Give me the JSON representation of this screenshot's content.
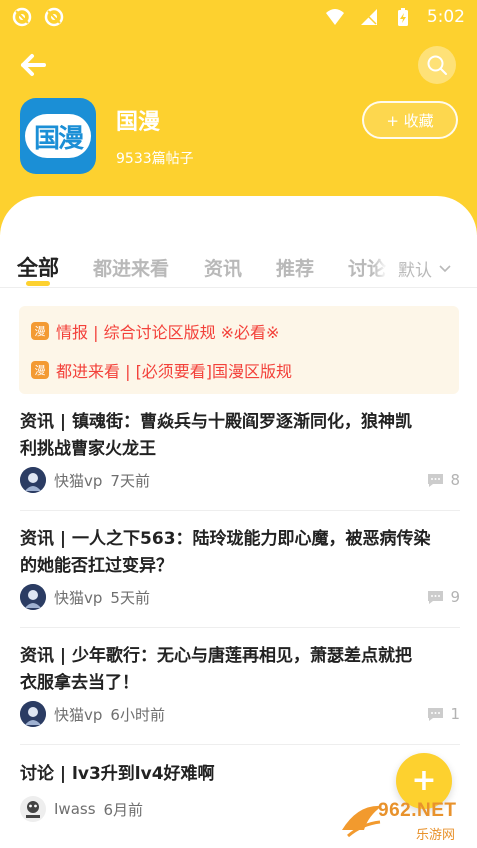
{
  "status_bar": {
    "time": "5:02"
  },
  "forum": {
    "logo_text": "国漫",
    "name": "国漫",
    "post_count": "9533篇帖子",
    "favorite_label": "+ 收藏"
  },
  "tabs": [
    {
      "label": "全部",
      "active": true
    },
    {
      "label": "都进来看",
      "active": false
    },
    {
      "label": "资讯",
      "active": false
    },
    {
      "label": "推荐",
      "active": false
    },
    {
      "label": "讨论",
      "active": false
    }
  ],
  "sort": {
    "selected": "默认"
  },
  "notices": [
    {
      "badge": "漫",
      "text": "情报 | 综合讨论区版规 ※必看※"
    },
    {
      "badge": "漫",
      "text": "都进来看 | [必须要看]国漫区版规"
    }
  ],
  "posts": [
    {
      "title_line1": "资讯 | 镇魂街：曹焱兵与十殿阎罗逐渐同化，狼神凯",
      "title_line2": "利挑战曹家火龙王",
      "author": "快猫vp",
      "time": "7天前",
      "comments": "8"
    },
    {
      "title_line1": "资讯 | 一人之下563：陆玲珑能力即心魔，被恶病传染",
      "title_line2": "的她能否扛过变异？",
      "author": "快猫vp",
      "time": "5天前",
      "comments": "9"
    },
    {
      "title_line1": "资讯 | 少年歌行：无心与唐莲再相见，萧瑟差点就把",
      "title_line2": "衣服拿去当了！",
      "author": "快猫vp",
      "time": "6小时前",
      "comments": "1"
    },
    {
      "title_line1": "讨论 | lv3升到lv4好难啊",
      "title_line2": "",
      "author": "Iwass",
      "time": "6月前",
      "comments": ""
    }
  ],
  "fab": {
    "label": "+"
  },
  "watermark": {
    "brand": "962.NET",
    "sub": "乐游网"
  },
  "colors": {
    "accent": "#fdd12f",
    "notice_red": "#f3413a",
    "notice_bg": "#fdf6e8",
    "badge_orange": "#f39a33",
    "logo_blue": "#1b8fd6"
  }
}
